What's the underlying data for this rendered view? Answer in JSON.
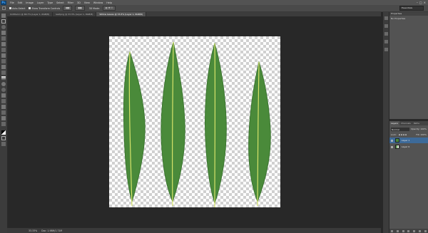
{
  "app": {
    "logo": "Ps"
  },
  "menu": [
    "File",
    "Edit",
    "Image",
    "Layer",
    "Type",
    "Select",
    "Filter",
    "3D",
    "View",
    "Window",
    "Help"
  ],
  "options": {
    "auto_select_label": "Auto-Select",
    "show_transform_label": "Show Transform Controls",
    "mode_3d_label": "3D Mode:",
    "workspace": "Essentials"
  },
  "tabs": [
    {
      "label": "Untitled-1 @ 66.7% (Layer 1, RGB/8)"
    },
    {
      "label": "leaf.png @ 33.3% (Layer 1, RGB/8)"
    },
    {
      "label": "Willow leaves @ 33.3% (Layer 1, RGB/8)"
    }
  ],
  "status": {
    "zoom": "33.33%",
    "doc": "Doc: 1.98M/1.71M"
  },
  "properties": {
    "title": "Properties",
    "empty_text": "No Properties"
  },
  "layers": {
    "tabs": [
      "Layers",
      "Channels",
      "Paths"
    ],
    "blend_mode": "Normal",
    "opacity_label": "Opacity:",
    "opacity": "100%",
    "lock_label": "Lock:",
    "fill_label": "Fill:",
    "fill": "100%",
    "items": [
      {
        "name": "Layer 1",
        "selected": true
      },
      {
        "name": "Layer 0",
        "selected": false
      }
    ]
  },
  "colors": {
    "leaf": "#4a8a3a",
    "leaf_dark": "#3b7530",
    "vein": "#d6e36a",
    "selected": "#3d6a99"
  }
}
